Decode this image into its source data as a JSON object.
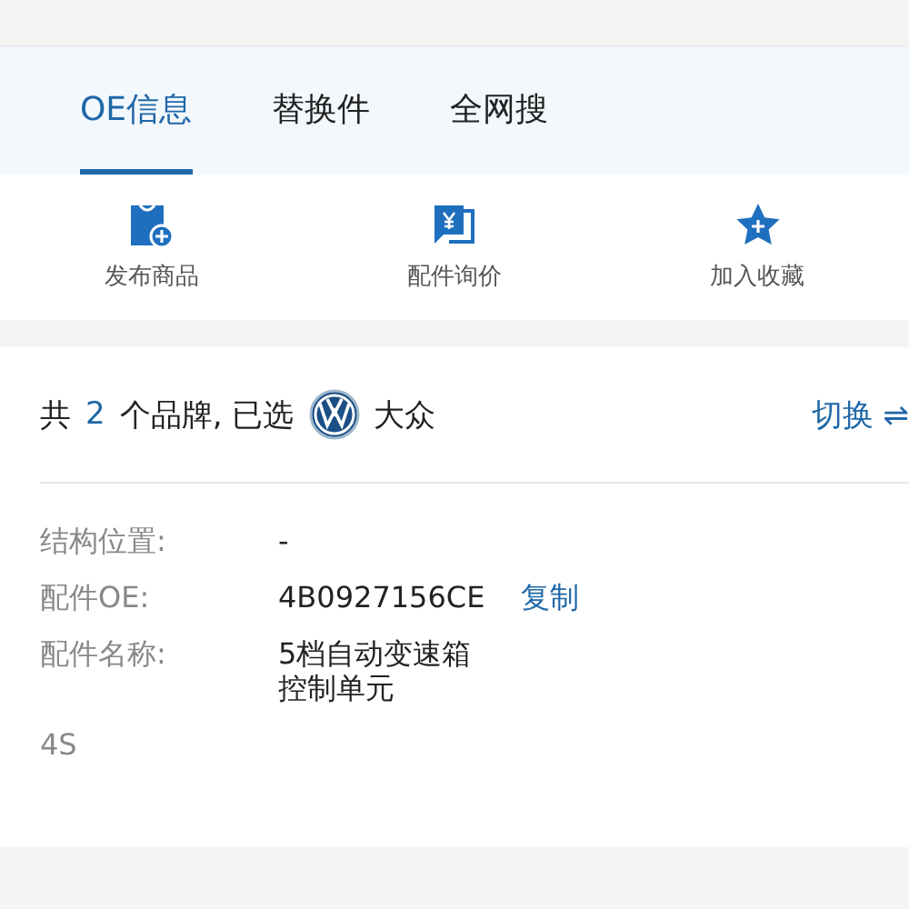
{
  "tabs": [
    {
      "label": "OE信息",
      "selected": true
    },
    {
      "label": "替换件",
      "selected": false
    },
    {
      "label": "全网搜",
      "selected": false
    }
  ],
  "actions": [
    {
      "kind": "publish",
      "label": "发布商品"
    },
    {
      "kind": "inquiry",
      "label": "配件询价"
    },
    {
      "kind": "favorite",
      "label": "加入收藏"
    }
  ],
  "brand_bar": {
    "prefix": "共",
    "count": "2",
    "middle": "个品牌, 已选",
    "brand": "大众",
    "switch_label": "切换",
    "switch_icon": "⇌"
  },
  "fields": [
    {
      "label": "结构位置:",
      "value": "-"
    },
    {
      "label": "配件OE:",
      "value": "4B0927156CE",
      "action": "复制"
    },
    {
      "label": "配件名称:",
      "value": "5档自动变速箱",
      "value_line_2": "控制单元"
    },
    {
      "label": "4S"
    }
  ]
}
